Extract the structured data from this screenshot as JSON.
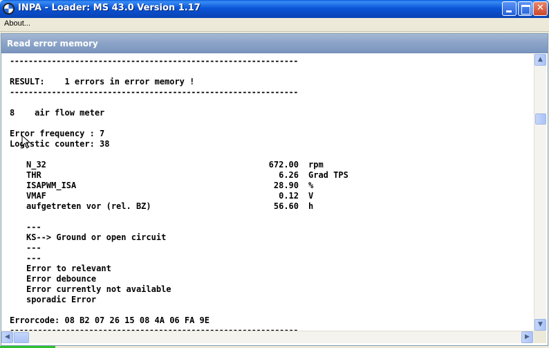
{
  "window": {
    "title": "INPA - Loader:  MS 43.0 Version 1.17"
  },
  "menu": {
    "about_label": "About..."
  },
  "child": {
    "title": "Read error memory"
  },
  "report": {
    "separator": "--------------------------------------------------------------",
    "result_line": "RESULT:    1 errors in error memory !",
    "error_code_line": "8    air flow meter",
    "frequency_line": "Error frequency : 7",
    "logistic_line": "Logistic counter: 38",
    "measurements": [
      {
        "name": "N_32",
        "value": "672.00",
        "unit": "rpm"
      },
      {
        "name": "THR",
        "value": "6.26",
        "unit": "Grad TPS"
      },
      {
        "name": "ISAPWM_ISA",
        "value": "28.90",
        "unit": "%"
      },
      {
        "name": "VMAF",
        "value": "0.12",
        "unit": "V"
      },
      {
        "name": "aufgetreten vor (rel. BZ)",
        "value": "56.60",
        "unit": "h"
      }
    ],
    "block_sep_1": "---",
    "ks_line": "KS--> Ground or open circuit",
    "block_sep_2": "---",
    "block_sep_3": "---",
    "status_lines": [
      "Error to relevant",
      "Error debounce",
      "Error currently not available",
      "sporadic Error"
    ],
    "errorcode_line": "Errorcode: 08 B2 07 26 15 08 4A 06 FA 9E"
  },
  "scrollbar": {
    "up_arrow": "▲",
    "down_arrow": "▼",
    "left_arrow": "◀",
    "right_arrow": "▶"
  },
  "caption_buttons": {
    "close_glyph": "✕"
  }
}
